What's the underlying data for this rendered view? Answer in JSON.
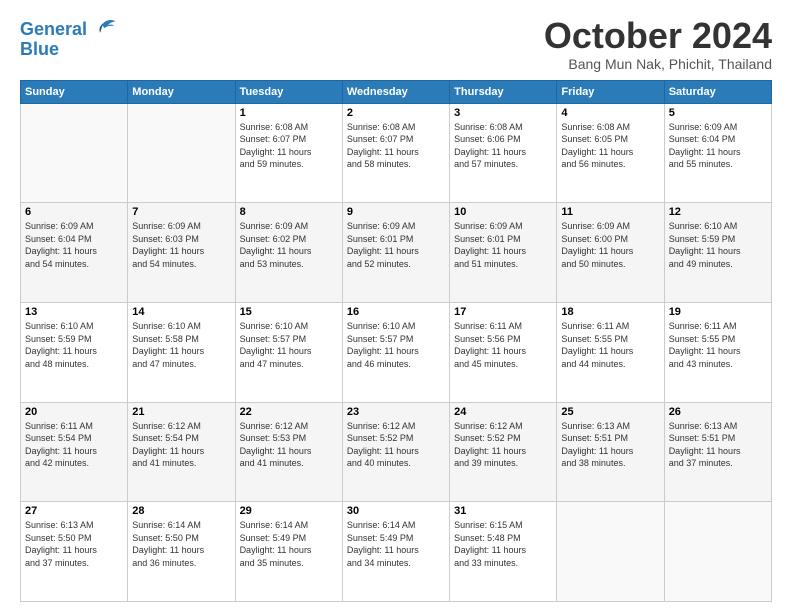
{
  "logo": {
    "line1": "General",
    "line2": "Blue"
  },
  "title": "October 2024",
  "subtitle": "Bang Mun Nak, Phichit, Thailand",
  "days_of_week": [
    "Sunday",
    "Monday",
    "Tuesday",
    "Wednesday",
    "Thursday",
    "Friday",
    "Saturday"
  ],
  "weeks": [
    [
      {
        "day": "",
        "info": ""
      },
      {
        "day": "",
        "info": ""
      },
      {
        "day": "1",
        "info": "Sunrise: 6:08 AM\nSunset: 6:07 PM\nDaylight: 11 hours\nand 59 minutes."
      },
      {
        "day": "2",
        "info": "Sunrise: 6:08 AM\nSunset: 6:07 PM\nDaylight: 11 hours\nand 58 minutes."
      },
      {
        "day": "3",
        "info": "Sunrise: 6:08 AM\nSunset: 6:06 PM\nDaylight: 11 hours\nand 57 minutes."
      },
      {
        "day": "4",
        "info": "Sunrise: 6:08 AM\nSunset: 6:05 PM\nDaylight: 11 hours\nand 56 minutes."
      },
      {
        "day": "5",
        "info": "Sunrise: 6:09 AM\nSunset: 6:04 PM\nDaylight: 11 hours\nand 55 minutes."
      }
    ],
    [
      {
        "day": "6",
        "info": "Sunrise: 6:09 AM\nSunset: 6:04 PM\nDaylight: 11 hours\nand 54 minutes."
      },
      {
        "day": "7",
        "info": "Sunrise: 6:09 AM\nSunset: 6:03 PM\nDaylight: 11 hours\nand 54 minutes."
      },
      {
        "day": "8",
        "info": "Sunrise: 6:09 AM\nSunset: 6:02 PM\nDaylight: 11 hours\nand 53 minutes."
      },
      {
        "day": "9",
        "info": "Sunrise: 6:09 AM\nSunset: 6:01 PM\nDaylight: 11 hours\nand 52 minutes."
      },
      {
        "day": "10",
        "info": "Sunrise: 6:09 AM\nSunset: 6:01 PM\nDaylight: 11 hours\nand 51 minutes."
      },
      {
        "day": "11",
        "info": "Sunrise: 6:09 AM\nSunset: 6:00 PM\nDaylight: 11 hours\nand 50 minutes."
      },
      {
        "day": "12",
        "info": "Sunrise: 6:10 AM\nSunset: 5:59 PM\nDaylight: 11 hours\nand 49 minutes."
      }
    ],
    [
      {
        "day": "13",
        "info": "Sunrise: 6:10 AM\nSunset: 5:59 PM\nDaylight: 11 hours\nand 48 minutes."
      },
      {
        "day": "14",
        "info": "Sunrise: 6:10 AM\nSunset: 5:58 PM\nDaylight: 11 hours\nand 47 minutes."
      },
      {
        "day": "15",
        "info": "Sunrise: 6:10 AM\nSunset: 5:57 PM\nDaylight: 11 hours\nand 47 minutes."
      },
      {
        "day": "16",
        "info": "Sunrise: 6:10 AM\nSunset: 5:57 PM\nDaylight: 11 hours\nand 46 minutes."
      },
      {
        "day": "17",
        "info": "Sunrise: 6:11 AM\nSunset: 5:56 PM\nDaylight: 11 hours\nand 45 minutes."
      },
      {
        "day": "18",
        "info": "Sunrise: 6:11 AM\nSunset: 5:55 PM\nDaylight: 11 hours\nand 44 minutes."
      },
      {
        "day": "19",
        "info": "Sunrise: 6:11 AM\nSunset: 5:55 PM\nDaylight: 11 hours\nand 43 minutes."
      }
    ],
    [
      {
        "day": "20",
        "info": "Sunrise: 6:11 AM\nSunset: 5:54 PM\nDaylight: 11 hours\nand 42 minutes."
      },
      {
        "day": "21",
        "info": "Sunrise: 6:12 AM\nSunset: 5:54 PM\nDaylight: 11 hours\nand 41 minutes."
      },
      {
        "day": "22",
        "info": "Sunrise: 6:12 AM\nSunset: 5:53 PM\nDaylight: 11 hours\nand 41 minutes."
      },
      {
        "day": "23",
        "info": "Sunrise: 6:12 AM\nSunset: 5:52 PM\nDaylight: 11 hours\nand 40 minutes."
      },
      {
        "day": "24",
        "info": "Sunrise: 6:12 AM\nSunset: 5:52 PM\nDaylight: 11 hours\nand 39 minutes."
      },
      {
        "day": "25",
        "info": "Sunrise: 6:13 AM\nSunset: 5:51 PM\nDaylight: 11 hours\nand 38 minutes."
      },
      {
        "day": "26",
        "info": "Sunrise: 6:13 AM\nSunset: 5:51 PM\nDaylight: 11 hours\nand 37 minutes."
      }
    ],
    [
      {
        "day": "27",
        "info": "Sunrise: 6:13 AM\nSunset: 5:50 PM\nDaylight: 11 hours\nand 37 minutes."
      },
      {
        "day": "28",
        "info": "Sunrise: 6:14 AM\nSunset: 5:50 PM\nDaylight: 11 hours\nand 36 minutes."
      },
      {
        "day": "29",
        "info": "Sunrise: 6:14 AM\nSunset: 5:49 PM\nDaylight: 11 hours\nand 35 minutes."
      },
      {
        "day": "30",
        "info": "Sunrise: 6:14 AM\nSunset: 5:49 PM\nDaylight: 11 hours\nand 34 minutes."
      },
      {
        "day": "31",
        "info": "Sunrise: 6:15 AM\nSunset: 5:48 PM\nDaylight: 11 hours\nand 33 minutes."
      },
      {
        "day": "",
        "info": ""
      },
      {
        "day": "",
        "info": ""
      }
    ]
  ]
}
